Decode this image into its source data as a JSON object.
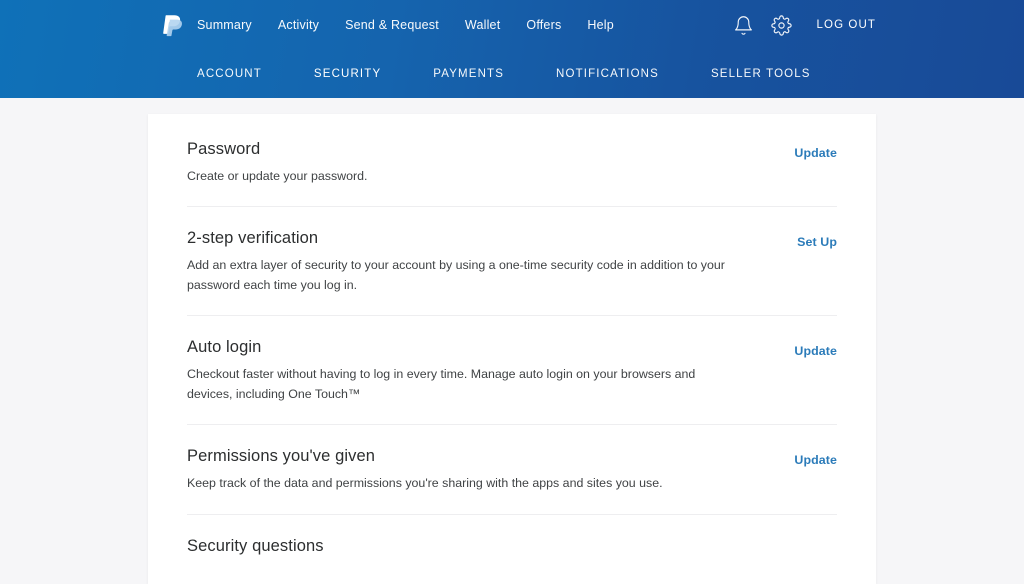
{
  "header": {
    "brand": {
      "logo_icon": "paypal-logo-icon",
      "name": "PayPal"
    },
    "top_nav": [
      {
        "label": "Summary"
      },
      {
        "label": "Activity"
      },
      {
        "label": "Send & Request"
      },
      {
        "label": "Wallet"
      },
      {
        "label": "Offers"
      },
      {
        "label": "Help"
      }
    ],
    "actions": {
      "notifications_icon": "bell-icon",
      "settings_icon": "gear-icon",
      "logout_label": "LOG OUT"
    },
    "sub_nav": [
      {
        "label": "ACCOUNT",
        "active": false
      },
      {
        "label": "SECURITY",
        "active": true
      },
      {
        "label": "PAYMENTS",
        "active": false
      },
      {
        "label": "NOTIFICATIONS",
        "active": false
      },
      {
        "label": "SELLER TOOLS",
        "active": false
      }
    ]
  },
  "main": {
    "sections": [
      {
        "title": "Password",
        "description": "Create or update your password.",
        "action": "Update"
      },
      {
        "title": "2-step verification",
        "description": "Add an extra layer of security to your account by using a one-time security code in addition to your password each time you log in.",
        "action": "Set Up"
      },
      {
        "title": "Auto login",
        "description": "Checkout faster without having to log in every time. Manage auto login on your browsers and devices, including One Touch™",
        "action": "Update"
      },
      {
        "title": "Permissions you've given",
        "description": "Keep track of the data and permissions you're sharing with the apps and sites you use.",
        "action": "Update"
      },
      {
        "title": "Security questions",
        "description": "",
        "action": ""
      }
    ]
  },
  "colors": {
    "header_gradient_start": "#0f71b8",
    "header_gradient_end": "#184a97",
    "link_blue": "#2b7bb9",
    "page_background": "#f6f6f8",
    "card_background": "#ffffff",
    "heading_text": "#2c2e2f",
    "body_text": "#404345",
    "divider": "#eeeef0"
  }
}
